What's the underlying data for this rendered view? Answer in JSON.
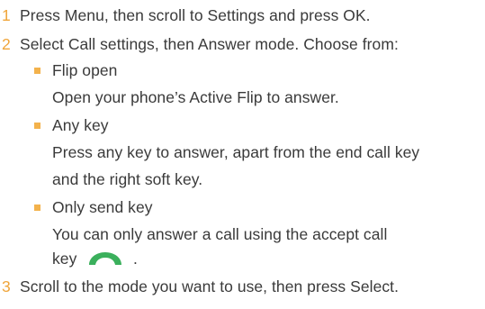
{
  "colors": {
    "text": "#3a3a3a",
    "accent": "#f0a53a",
    "bullet": "#f3b24c",
    "call_icon": "#3bb05c"
  },
  "steps": [
    {
      "number": "1",
      "text": "Press Menu, then scroll to Settings and press OK."
    },
    {
      "number": "2",
      "text": "Select Call settings, then Answer mode. Choose from:",
      "options": [
        {
          "title": "Flip open",
          "description_lines": [
            "Open your phone’s Active Flip to answer."
          ]
        },
        {
          "title": "Any key",
          "description_lines": [
            "Press any key to answer, apart from the end call key",
            "and the right soft key."
          ]
        },
        {
          "title": "Only send key",
          "description_lines": [
            "You can only answer a call using the accept call",
            "key"
          ],
          "trailing_icon": "accept-call-icon",
          "trailing_text": "."
        }
      ]
    },
    {
      "number": "3",
      "text": "Scroll to the mode you want to use, then press Select."
    }
  ]
}
